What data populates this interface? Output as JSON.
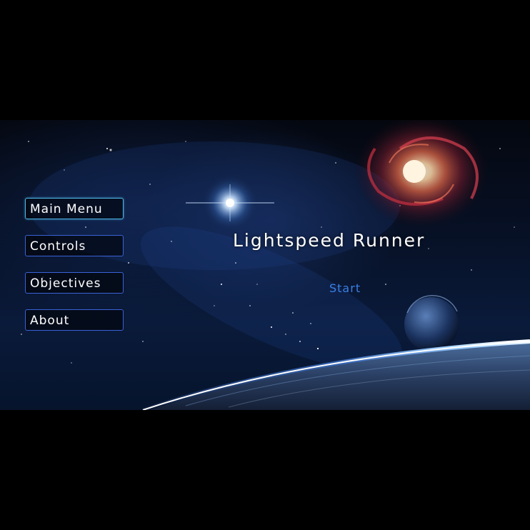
{
  "menu": {
    "items": [
      {
        "label": "Main Menu",
        "active": true
      },
      {
        "label": "Controls",
        "active": false
      },
      {
        "label": "Objectives",
        "active": false
      },
      {
        "label": "About",
        "active": false
      }
    ]
  },
  "title": "Lightspeed Runner",
  "start_label": "Start",
  "colors": {
    "background": "#000000",
    "button_border": "#3a62d6",
    "active_border": "#4fb6e8",
    "start_link": "#3a7fe6",
    "text": "#ffffff"
  },
  "icons": [
    "galaxy-image",
    "star-flare-image",
    "planet-image",
    "planet-horizon-image"
  ]
}
